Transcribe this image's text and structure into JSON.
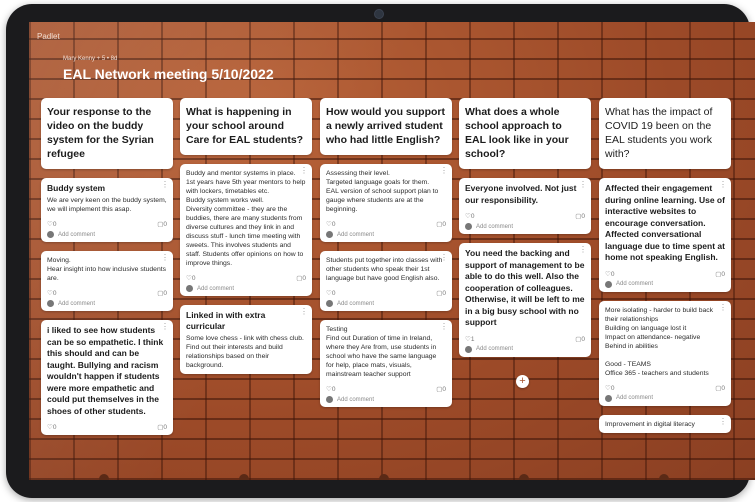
{
  "app": {
    "name": "Padlet"
  },
  "board": {
    "byline": "Mary Kenny + 5 • 8d",
    "title": "EAL Network meeting 5/10/2022"
  },
  "common": {
    "add_comment": "Add comment",
    "more": "⋮"
  },
  "columns": [
    {
      "header": "Your response to the video on the buddy system for the Syrian refugee",
      "posts": [
        {
          "title": "Buddy system",
          "body": "We are very keen on the buddy system, we will implement this asap.",
          "likes": "0",
          "comments": "0"
        },
        {
          "title": "",
          "body": "Moving.\nHear insight into how inclusive students are.",
          "likes": "0",
          "comments": "0"
        },
        {
          "title": "",
          "body": "i liked to see how students can be so empathetic. I think this should and can be taught. Bullying and racism wouldn't happen if students were more empathetic and could put themselves in the shoes of other students.",
          "likes": "0",
          "comments": "0"
        }
      ]
    },
    {
      "header": "What is happening in your school around Care for EAL students?",
      "posts": [
        {
          "title": "",
          "body": "Buddy and mentor systems in place.\n1st years have 5th year mentors to help with lockers, timetables etc.\nBuddy system works well.\nDiversity committee - they are the buddies, there are many students from diverse cultures and they link in and discuss stuff - lunch time meeting with sweets. This involves students and staff. Students offer opinions on how to improve things.",
          "likes": "0",
          "comments": "0"
        },
        {
          "title": "Linked in with extra curricular",
          "body": "Some love chess - link with chess club.\nFind out their interests and build relationships based on their background.",
          "likes": "",
          "comments": ""
        }
      ]
    },
    {
      "header": "How would you support a newly arrived student who had little English?",
      "posts": [
        {
          "title": "",
          "body": "Assessing their level.\nTargeted language goals for them.\nEAL version of school support plan to gauge where students are at the beginning.",
          "likes": "0",
          "comments": "0"
        },
        {
          "title": "",
          "body": "Students put together into classes with other students who speak their 1st language but have good English also.",
          "likes": "0",
          "comments": "0"
        },
        {
          "title": "Testing",
          "body": "Find out Duration of time in Ireland, where they Are from, use students in school who have the same language for help, place mats, visuals, mainstream teacher support",
          "likes": "0",
          "comments": "0"
        }
      ]
    },
    {
      "header": "What does a whole school approach to EAL look like in your school?",
      "posts": [
        {
          "title": "",
          "body": "Everyone involved. Not just our responsibility.",
          "likes": "0",
          "comments": "0"
        },
        {
          "title": "",
          "body": "You need the backing and support of management to be able to do this well. Also the cooperation of colleagues. Otherwise, it will be left to me in a big busy school with no support",
          "likes": "1",
          "comments": "0"
        }
      ]
    },
    {
      "header": "What has the impact of COVID 19 been on the EAL students you work with?",
      "posts": [
        {
          "title": "",
          "body": "Affected their engagement during online learning. Use of interactive websites to encourage conversation. Affected conversational language due to time spent at home not speaking English.",
          "likes": "0",
          "comments": "0"
        },
        {
          "title": "",
          "body": "More isolating - harder to build back their relationships\nBuilding on language lost it\nImpact on attendance- negative\nBehind in abilities\n\nGood - TEAMS\nOffice 365 - teachers and students",
          "likes": "0",
          "comments": "0"
        },
        {
          "title": "",
          "body": "Improvement in digital literacy",
          "likes": "",
          "comments": ""
        }
      ]
    }
  ],
  "add_post_label": "+"
}
